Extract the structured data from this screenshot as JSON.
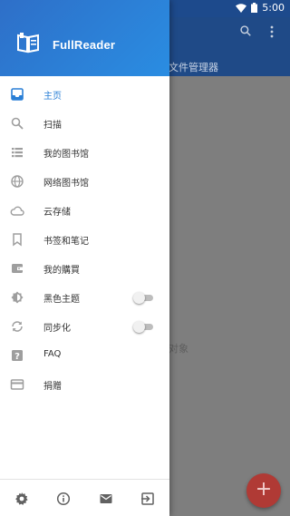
{
  "status_bar": {
    "time": "5:00"
  },
  "background_app": {
    "tab_label": "文件管理器",
    "empty_text": "对象",
    "fab_label": "+"
  },
  "drawer": {
    "app_title": "FullReader",
    "items": [
      {
        "label": "主页",
        "icon": "inbox-icon",
        "active": true
      },
      {
        "label": "扫描",
        "icon": "search-icon"
      },
      {
        "label": "我的图书馆",
        "icon": "list-icon"
      },
      {
        "label": "网络图书馆",
        "icon": "globe-icon"
      },
      {
        "label": "云存储",
        "icon": "cloud-icon"
      },
      {
        "label": "书签和笔记",
        "icon": "bookmark-icon"
      },
      {
        "label": "我的購買",
        "icon": "wallet-icon"
      },
      {
        "label": "黑色主题",
        "icon": "theme-icon",
        "toggle": false
      },
      {
        "label": "同步化",
        "icon": "sync-icon",
        "toggle": false
      },
      {
        "label": "FAQ",
        "icon": "help-icon"
      },
      {
        "label": "捐赠",
        "icon": "card-icon"
      }
    ],
    "bottom_icons": [
      "settings-icon",
      "info-icon",
      "mail-icon",
      "exit-icon"
    ]
  },
  "colors": {
    "accent": "#2a7fd6",
    "header_start": "#2e6fc8",
    "header_end": "#2a8de2",
    "fab": "#b03a35",
    "icon_gray": "#9e9e9e"
  }
}
